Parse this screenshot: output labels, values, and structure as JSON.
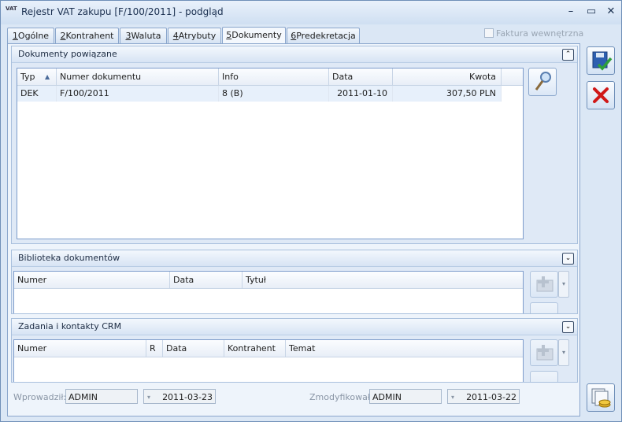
{
  "window": {
    "title": "Rejestr VAT zakupu [F/100/2011] - podgląd",
    "icon_text": "VAT"
  },
  "titlebar_buttons": {
    "minimize": "–",
    "maximize": "▭",
    "close": "✕"
  },
  "tabs": [
    {
      "key": "1",
      "label": "Ogólne"
    },
    {
      "key": "2",
      "label": "Kontrahent"
    },
    {
      "key": "3",
      "label": "Waluta"
    },
    {
      "key": "4",
      "label": "Atrybuty"
    },
    {
      "key": "5",
      "label": "Dokumenty"
    },
    {
      "key": "6",
      "label": "Predekretacja"
    }
  ],
  "active_tab": "Dokumenty",
  "faktura_wewnetrzna": {
    "label": "Faktura wewnętrzna",
    "checked": false
  },
  "dokumenty_powiazane": {
    "title": "Dokumenty powiązane",
    "columns": [
      "Typ",
      "Numer dokumentu",
      "Info",
      "Data",
      "Kwota"
    ],
    "sort_indicator": "▲",
    "rows": [
      {
        "typ": "DEK",
        "numer": "F/100/2011",
        "info": "8 (B)",
        "data": "2011-01-10",
        "kwota": "307,50 PLN"
      }
    ]
  },
  "biblioteka": {
    "title": "Biblioteka dokumentów",
    "columns": [
      "Numer",
      "Data",
      "Tytuł"
    ]
  },
  "crm": {
    "title": "Zadania i kontakty CRM",
    "columns": [
      "Numer",
      "R",
      "Data",
      "Kontrahent",
      "Temat"
    ]
  },
  "footer": {
    "wprowadzil_label": "Wprowadził:",
    "wprowadzil_user": "ADMIN",
    "wprowadzil_date": "2011-03-23",
    "zmodyfikowal_label": "Zmodyfikował:",
    "zmodyfikowal_user": "ADMIN",
    "zmodyfikowal_date": "2011-03-22"
  },
  "colors": {
    "accent": "#6f8fb8",
    "row_selected": "#e7f0fb",
    "cancel_red": "#d01818",
    "confirm_green": "#2fa03a"
  }
}
